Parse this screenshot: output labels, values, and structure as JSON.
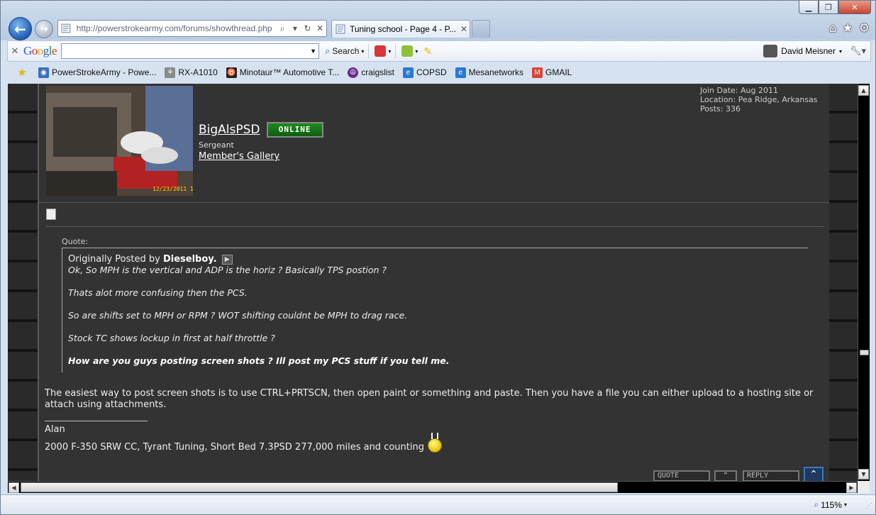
{
  "browser": {
    "address_url": "http://powerstrokearmy.com/forums/showthread.php",
    "tab_title": "Tuning school - Page 4 - P...",
    "user": "David Meisner",
    "zoom": "115%"
  },
  "toolbar": {
    "brand": "Google",
    "search_value": "",
    "search_label": "Search"
  },
  "favorites": [
    {
      "label": "PowerStrokeArmy - Powe...",
      "icon": "globe-icon",
      "color": "#3b6fbf"
    },
    {
      "label": "RX-A1010",
      "icon": "yamaha-icon",
      "color": "#8a8a8a"
    },
    {
      "label": "Minotaur™ Automotive T...",
      "icon": "minotaur-icon",
      "color": "#222222"
    },
    {
      "label": "craigslist",
      "icon": "peace-icon",
      "color": "#6a2a8a"
    },
    {
      "label": "COPSD",
      "icon": "ie-page-icon",
      "color": "#2a7ad0"
    },
    {
      "label": "Mesanetworks",
      "icon": "ie-page-icon",
      "color": "#2a7ad0"
    },
    {
      "label": "GMAIL",
      "icon": "gmail-icon",
      "color": "#d44638"
    }
  ],
  "post": {
    "username": "BigAlsPSD",
    "online_badge": "ONLINE",
    "rank": "Sergeant",
    "gallery_link": "Member's Gallery",
    "join_date": "Join Date: Aug 2011",
    "location": "Location: Pea Ridge, Arkansas",
    "posts": "Posts: 336",
    "quote": {
      "label": "Quote:",
      "posted_by_prefix": "Originally Posted by",
      "author": "Dieselboy.",
      "lines": [
        "Ok, So MPH is the vertical and ADP is the horiz ? Basically TPS postion ?",
        "Thats alot more confusing then the PCS.",
        "So are shifts set to MPH or RPM ? WOT shifting couldnt be MPH to drag race.",
        "Stock TC shows lockup in first at half throttle ?",
        "How are you guys posting screen shots ? Ill post my PCS stuff if you tell me."
      ]
    },
    "reply_text": "The easiest way to post screen shots is to use CTRL+PRTSCN, then open paint or something and paste. Then you have a file you can either upload to a hosting site or attach using attachments.",
    "signature_name": "Alan",
    "signature_text": "2000 F-350 SRW CC, Tyrant Tuning, Short Bed 7.3PSD 277,000 miles and counting",
    "buttons": {
      "quote": "QUOTE",
      "multiquote": "“",
      "reply": "REPLY"
    }
  }
}
